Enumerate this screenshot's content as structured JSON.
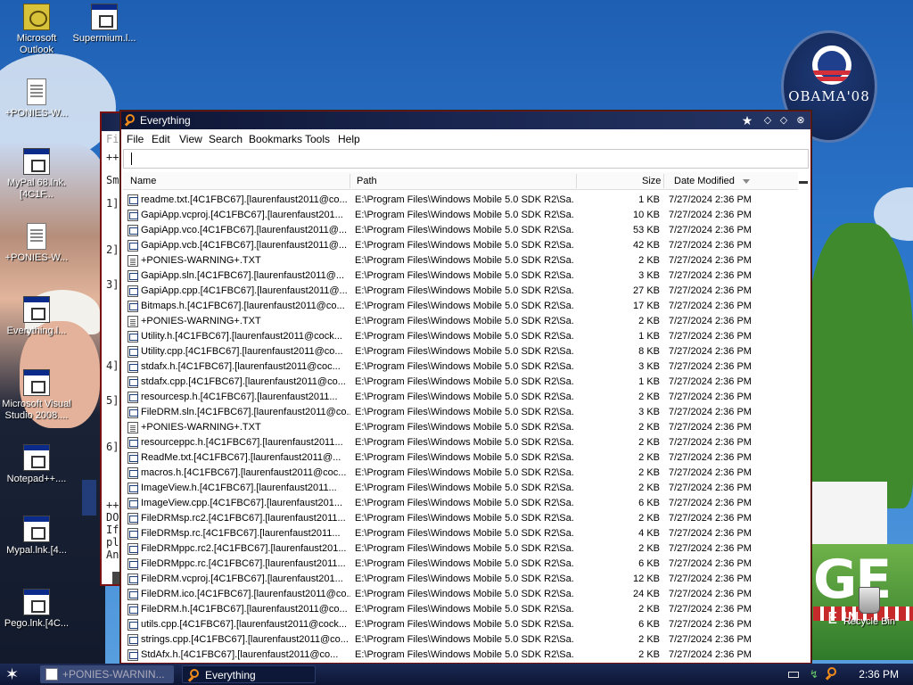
{
  "desktop": {
    "icons": [
      {
        "label": "Microsoft Outlook",
        "icon": "outlook-icon"
      },
      {
        "label": "Supermium.l...",
        "icon": "shortcut-icon"
      },
      {
        "label": "+PONIES-W...",
        "icon": "text-file-icon"
      },
      {
        "label": "MyPal 68.lnk.[4C1F...",
        "icon": "shortcut-icon"
      },
      {
        "label": "+PONIES-W...",
        "icon": "text-file-icon"
      },
      {
        "label": "Everything.l...",
        "icon": "shortcut-icon"
      },
      {
        "label": "Microsoft Visual Studio 2008....",
        "icon": "shortcut-icon"
      },
      {
        "label": "Notepad++....",
        "icon": "shortcut-icon"
      },
      {
        "label": "Mypal.lnk.[4...",
        "icon": "shortcut-icon"
      },
      {
        "label": "Pego.lnk.[4C...",
        "icon": "shortcut-icon"
      },
      {
        "label": "Recycle Bin",
        "icon": "recycle-bin-icon"
      }
    ],
    "wallpaper": {
      "badge_text": "OBAMA'08",
      "big_letters": "GE",
      "small_letters": "E IN"
    }
  },
  "background_window": {
    "lines": [
      "Fil",
      "++",
      "Sm",
      "1]",
      "2]",
      "3]",
      "4]",
      "5]",
      "6]",
      "++",
      "DO",
      "If",
      "pl",
      "An"
    ]
  },
  "window": {
    "title": "Everything",
    "menu": [
      "File",
      "Edit",
      "View",
      "Search",
      "Bookmarks",
      "Tools",
      "Help"
    ],
    "search": {
      "value": "",
      "placeholder": ""
    },
    "columns": {
      "name": "Name",
      "path": "Path",
      "size": "Size",
      "date": "Date Modified"
    },
    "rows": [
      {
        "name": "readme.txt.[4C1FBC67].[laurenfaust2011@co...",
        "path": "E:\\Program Files\\Windows Mobile 5.0 SDK R2\\Sa...",
        "size": "1 KB",
        "date": "7/27/2024 2:36 PM",
        "type": "src"
      },
      {
        "name": "GapiApp.vcproj.[4C1FBC67].[laurenfaust201...",
        "path": "E:\\Program Files\\Windows Mobile 5.0 SDK R2\\Sa...",
        "size": "10 KB",
        "date": "7/27/2024 2:36 PM",
        "type": "src"
      },
      {
        "name": "GapiApp.vco.[4C1FBC67].[laurenfaust2011@...",
        "path": "E:\\Program Files\\Windows Mobile 5.0 SDK R2\\Sa...",
        "size": "53 KB",
        "date": "7/27/2024 2:36 PM",
        "type": "src"
      },
      {
        "name": "GapiApp.vcb.[4C1FBC67].[laurenfaust2011@...",
        "path": "E:\\Program Files\\Windows Mobile 5.0 SDK R2\\Sa...",
        "size": "42 KB",
        "date": "7/27/2024 2:36 PM",
        "type": "src"
      },
      {
        "name": "+PONIES-WARNING+.TXT",
        "path": "E:\\Program Files\\Windows Mobile 5.0 SDK R2\\Sa...",
        "size": "2 KB",
        "date": "7/27/2024 2:36 PM",
        "type": "txt"
      },
      {
        "name": "GapiApp.sln.[4C1FBC67].[laurenfaust2011@...",
        "path": "E:\\Program Files\\Windows Mobile 5.0 SDK R2\\Sa...",
        "size": "3 KB",
        "date": "7/27/2024 2:36 PM",
        "type": "src"
      },
      {
        "name": "GapiApp.cpp.[4C1FBC67].[laurenfaust2011@...",
        "path": "E:\\Program Files\\Windows Mobile 5.0 SDK R2\\Sa...",
        "size": "27 KB",
        "date": "7/27/2024 2:36 PM",
        "type": "src"
      },
      {
        "name": "Bitmaps.h.[4C1FBC67].[laurenfaust2011@co...",
        "path": "E:\\Program Files\\Windows Mobile 5.0 SDK R2\\Sa...",
        "size": "17 KB",
        "date": "7/27/2024 2:36 PM",
        "type": "src"
      },
      {
        "name": "+PONIES-WARNING+.TXT",
        "path": "E:\\Program Files\\Windows Mobile 5.0 SDK R2\\Sa...",
        "size": "2 KB",
        "date": "7/27/2024 2:36 PM",
        "type": "txt"
      },
      {
        "name": "Utility.h.[4C1FBC67].[laurenfaust2011@cock...",
        "path": "E:\\Program Files\\Windows Mobile 5.0 SDK R2\\Sa...",
        "size": "1 KB",
        "date": "7/27/2024 2:36 PM",
        "type": "src"
      },
      {
        "name": "Utility.cpp.[4C1FBC67].[laurenfaust2011@co...",
        "path": "E:\\Program Files\\Windows Mobile 5.0 SDK R2\\Sa...",
        "size": "8 KB",
        "date": "7/27/2024 2:36 PM",
        "type": "src"
      },
      {
        "name": "stdafx.h.[4C1FBC67].[laurenfaust2011@coc...",
        "path": "E:\\Program Files\\Windows Mobile 5.0 SDK R2\\Sa...",
        "size": "3 KB",
        "date": "7/27/2024 2:36 PM",
        "type": "src"
      },
      {
        "name": "stdafx.cpp.[4C1FBC67].[laurenfaust2011@co...",
        "path": "E:\\Program Files\\Windows Mobile 5.0 SDK R2\\Sa...",
        "size": "1 KB",
        "date": "7/27/2024 2:36 PM",
        "type": "src"
      },
      {
        "name": "resourcesp.h.[4C1FBC67].[laurenfaust2011...",
        "path": "E:\\Program Files\\Windows Mobile 5.0 SDK R2\\Sa...",
        "size": "2 KB",
        "date": "7/27/2024 2:36 PM",
        "type": "src"
      },
      {
        "name": "FileDRM.sln.[4C1FBC67].[laurenfaust2011@co...",
        "path": "E:\\Program Files\\Windows Mobile 5.0 SDK R2\\Sa...",
        "size": "3 KB",
        "date": "7/27/2024 2:36 PM",
        "type": "src"
      },
      {
        "name": "+PONIES-WARNING+.TXT",
        "path": "E:\\Program Files\\Windows Mobile 5.0 SDK R2\\Sa...",
        "size": "2 KB",
        "date": "7/27/2024 2:36 PM",
        "type": "txt"
      },
      {
        "name": "resourceppc.h.[4C1FBC67].[laurenfaust2011...",
        "path": "E:\\Program Files\\Windows Mobile 5.0 SDK R2\\Sa...",
        "size": "2 KB",
        "date": "7/27/2024 2:36 PM",
        "type": "src"
      },
      {
        "name": "ReadMe.txt.[4C1FBC67].[laurenfaust2011@...",
        "path": "E:\\Program Files\\Windows Mobile 5.0 SDK R2\\Sa...",
        "size": "2 KB",
        "date": "7/27/2024 2:36 PM",
        "type": "src"
      },
      {
        "name": "macros.h.[4C1FBC67].[laurenfaust2011@coc...",
        "path": "E:\\Program Files\\Windows Mobile 5.0 SDK R2\\Sa...",
        "size": "2 KB",
        "date": "7/27/2024 2:36 PM",
        "type": "src"
      },
      {
        "name": "ImageView.h.[4C1FBC67].[laurenfaust2011...",
        "path": "E:\\Program Files\\Windows Mobile 5.0 SDK R2\\Sa...",
        "size": "2 KB",
        "date": "7/27/2024 2:36 PM",
        "type": "src"
      },
      {
        "name": "ImageView.cpp.[4C1FBC67].[laurenfaust201...",
        "path": "E:\\Program Files\\Windows Mobile 5.0 SDK R2\\Sa...",
        "size": "6 KB",
        "date": "7/27/2024 2:36 PM",
        "type": "src"
      },
      {
        "name": "FileDRMsp.rc2.[4C1FBC67].[laurenfaust2011...",
        "path": "E:\\Program Files\\Windows Mobile 5.0 SDK R2\\Sa...",
        "size": "2 KB",
        "date": "7/27/2024 2:36 PM",
        "type": "src"
      },
      {
        "name": "FileDRMsp.rc.[4C1FBC67].[laurenfaust2011...",
        "path": "E:\\Program Files\\Windows Mobile 5.0 SDK R2\\Sa...",
        "size": "4 KB",
        "date": "7/27/2024 2:36 PM",
        "type": "src"
      },
      {
        "name": "FileDRMppc.rc2.[4C1FBC67].[laurenfaust201...",
        "path": "E:\\Program Files\\Windows Mobile 5.0 SDK R2\\Sa...",
        "size": "2 KB",
        "date": "7/27/2024 2:36 PM",
        "type": "src"
      },
      {
        "name": "FileDRMppc.rc.[4C1FBC67].[laurenfaust2011...",
        "path": "E:\\Program Files\\Windows Mobile 5.0 SDK R2\\Sa...",
        "size": "6 KB",
        "date": "7/27/2024 2:36 PM",
        "type": "src"
      },
      {
        "name": "FileDRM.vcproj.[4C1FBC67].[laurenfaust201...",
        "path": "E:\\Program Files\\Windows Mobile 5.0 SDK R2\\Sa...",
        "size": "12 KB",
        "date": "7/27/2024 2:36 PM",
        "type": "src"
      },
      {
        "name": "FileDRM.ico.[4C1FBC67].[laurenfaust2011@co...",
        "path": "E:\\Program Files\\Windows Mobile 5.0 SDK R2\\Sa...",
        "size": "24 KB",
        "date": "7/27/2024 2:36 PM",
        "type": "src"
      },
      {
        "name": "FileDRM.h.[4C1FBC67].[laurenfaust2011@co...",
        "path": "E:\\Program Files\\Windows Mobile 5.0 SDK R2\\Sa...",
        "size": "2 KB",
        "date": "7/27/2024 2:36 PM",
        "type": "src"
      },
      {
        "name": "utils.cpp.[4C1FBC67].[laurenfaust2011@cock...",
        "path": "E:\\Program Files\\Windows Mobile 5.0 SDK R2\\Sa...",
        "size": "6 KB",
        "date": "7/27/2024 2:36 PM",
        "type": "src"
      },
      {
        "name": "strings.cpp.[4C1FBC67].[laurenfaust2011@co...",
        "path": "E:\\Program Files\\Windows Mobile 5.0 SDK R2\\Sa...",
        "size": "2 KB",
        "date": "7/27/2024 2:36 PM",
        "type": "src"
      },
      {
        "name": "StdAfx.h.[4C1FBC67].[laurenfaust2011@co...",
        "path": "E:\\Program Files\\Windows Mobile 5.0 SDK R2\\Sa...",
        "size": "2 KB",
        "date": "7/27/2024 2:36 PM",
        "type": "src"
      }
    ]
  },
  "taskbar": {
    "tasks": [
      {
        "label": "+PONIES-WARNIN...",
        "icon": "text-file-icon"
      },
      {
        "label": "Everything",
        "icon": "magnifier-icon"
      }
    ],
    "clock": "2:36 PM"
  },
  "colors": {
    "title_dark": "#0e1634",
    "window_border": "#7b1010",
    "accent_orange": "#f08a1a"
  }
}
